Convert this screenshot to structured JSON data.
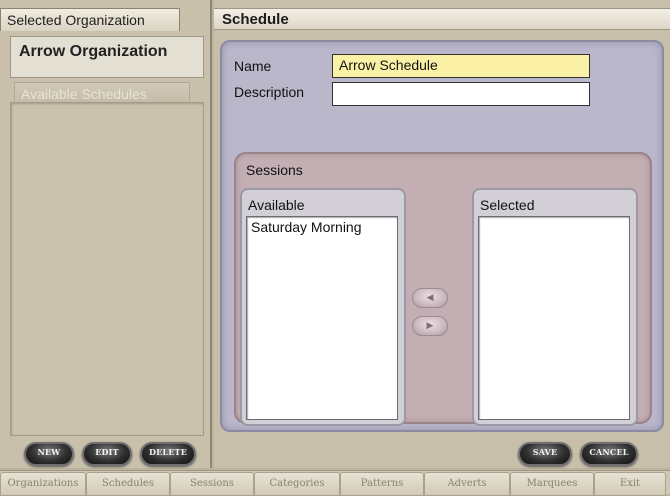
{
  "left": {
    "selected_org_tab": "Selected Organization",
    "org_name": "Arrow Organization",
    "available_schedules_tab": "Available Schedules",
    "buttons": {
      "new": "NEW",
      "edit": "EDIT",
      "delete": "DELETE"
    }
  },
  "schedule": {
    "header": "Schedule",
    "name_label": "Name",
    "name_value": "Arrow Schedule",
    "description_label": "Description",
    "description_value": "",
    "sessions_label": "Sessions",
    "available_label": "Available",
    "selected_label": "Selected",
    "available_items": [
      "Saturday Morning"
    ],
    "selected_items": [],
    "buttons": {
      "save": "SAVE",
      "cancel": "CANCEL"
    }
  },
  "nav": [
    "Organizations",
    "Schedules",
    "Sessions",
    "Categories",
    "Patterns",
    "Adverts",
    "Marquees",
    "Exit"
  ],
  "colors": {
    "name_field_bg": "#fbf1a6",
    "panel_bg": "#b9b7c9",
    "sessions_bg": "#c2aeb3",
    "pill_button": "#2f2f2f"
  }
}
